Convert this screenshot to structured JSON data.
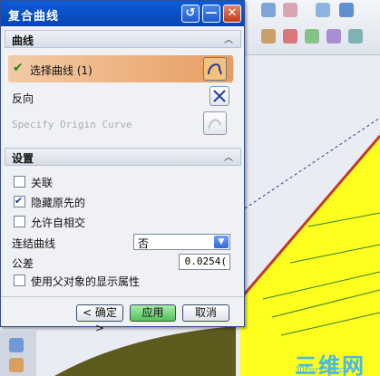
{
  "dialog": {
    "title": "复合曲线",
    "window_buttons": [
      "reset-icon",
      "minimize-icon",
      "close-icon"
    ]
  },
  "curve_section": {
    "header": "曲线",
    "select_curve_label": "选择曲线 (1)",
    "reverse_label": "反向",
    "specify_origin_label": "Specify Origin Curve"
  },
  "settings_section": {
    "header": "设置",
    "associative": {
      "label": "关联",
      "checked": false
    },
    "hide_original": {
      "label": "隐藏原先的",
      "checked": true
    },
    "allow_self_intersect": {
      "label": "允许自相交",
      "checked": false
    },
    "join_curves": {
      "label": "连结曲线",
      "value": "否"
    },
    "tolerance": {
      "label": "公差",
      "value": "0.0254("
    },
    "use_parent_display": {
      "label": "使用父对象的显示属性",
      "checked": false
    }
  },
  "footer": {
    "ok_label": "< 确定 >",
    "apply_label": "应用",
    "cancel_label": "取消"
  },
  "watermark": {
    "text": "三维网",
    "sub": "3DPortal.cn"
  },
  "colors": {
    "titlebar": "#0a52cc",
    "selection_row": "#eda56a",
    "model_yellow": "#ffff1f",
    "model_dark": "#5c5a1c"
  }
}
